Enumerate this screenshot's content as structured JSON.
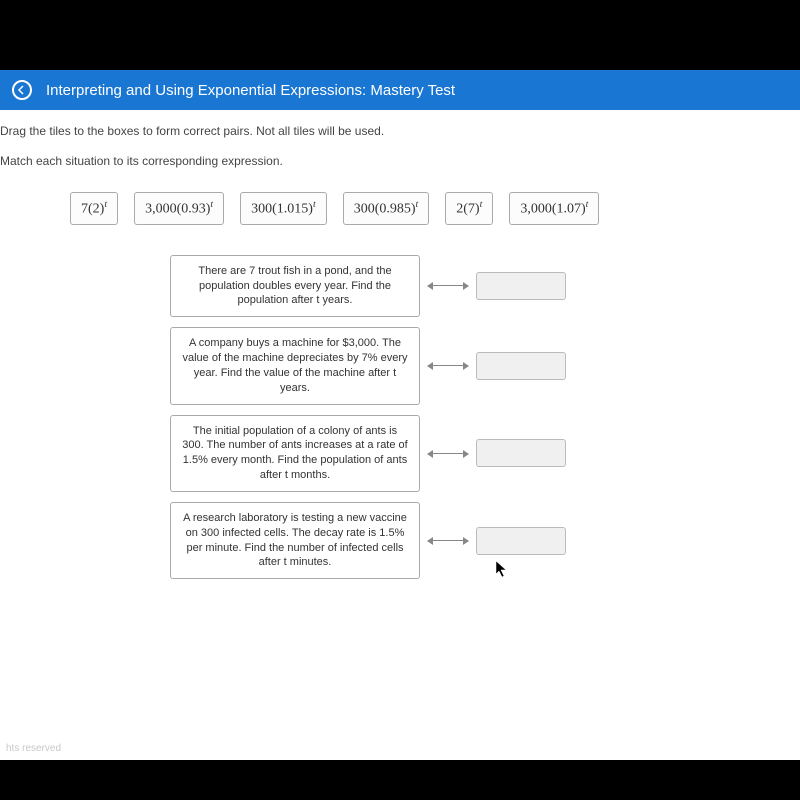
{
  "header": {
    "title": "Interpreting and Using Exponential Expressions: Mastery Test"
  },
  "instructions": {
    "line1": "Drag the tiles to the boxes to form correct pairs. Not all tiles will be used.",
    "line2": "Match each situation to its corresponding expression."
  },
  "tiles": [
    {
      "base": "7(2)",
      "exp": "t"
    },
    {
      "base": "3,000(0.93)",
      "exp": "t"
    },
    {
      "base": "300(1.015)",
      "exp": "t"
    },
    {
      "base": "300(0.985)",
      "exp": "t"
    },
    {
      "base": "2(7)",
      "exp": "t"
    },
    {
      "base": "3,000(1.07)",
      "exp": "t"
    }
  ],
  "situations": [
    "There are 7 trout fish in a pond, and the population doubles every year. Find the population after t years.",
    "A company buys a machine for $3,000. The value of the machine depreciates by 7% every year. Find the value of the machine after t years.",
    "The initial population of a colony of ants is 300. The number of ants increases at a rate of 1.5% every month. Find the population of ants after t months.",
    "A research laboratory is testing a new vaccine on 300 infected cells. The decay rate is 1.5% per minute. Find the number of infected cells after t minutes."
  ],
  "footer": "hts reserved"
}
